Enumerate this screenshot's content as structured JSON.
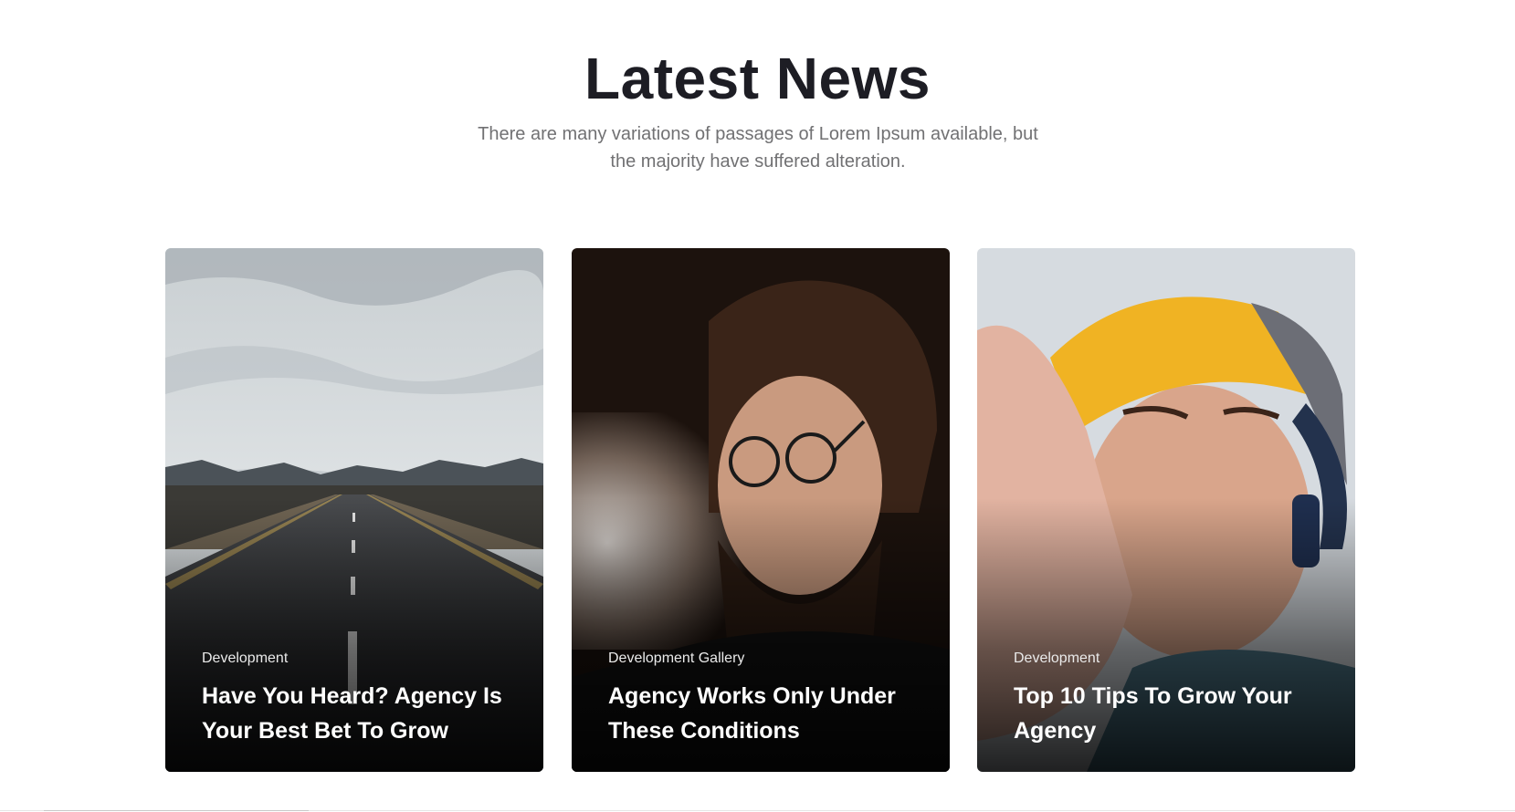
{
  "section": {
    "title": "Latest News",
    "subtitle": "There are many variations of passages of Lorem Ipsum available, but the majority have suffered alteration."
  },
  "cards": [
    {
      "category": "Development",
      "title": "Have You Heard? Agency Is Your Best Bet To Grow",
      "image": "desert-road-photo"
    },
    {
      "category": "Development Gallery",
      "title": "Agency Works Only Under These Conditions",
      "image": "bearded-man-glasses-photo"
    },
    {
      "category": "Development",
      "title": "Top 10 Tips To Grow Your Agency",
      "image": "man-yellow-cap-headphones-photo"
    }
  ],
  "colors": {
    "heading": "#1d1d24",
    "subtitle": "#717173",
    "card_text": "#ffffff"
  }
}
